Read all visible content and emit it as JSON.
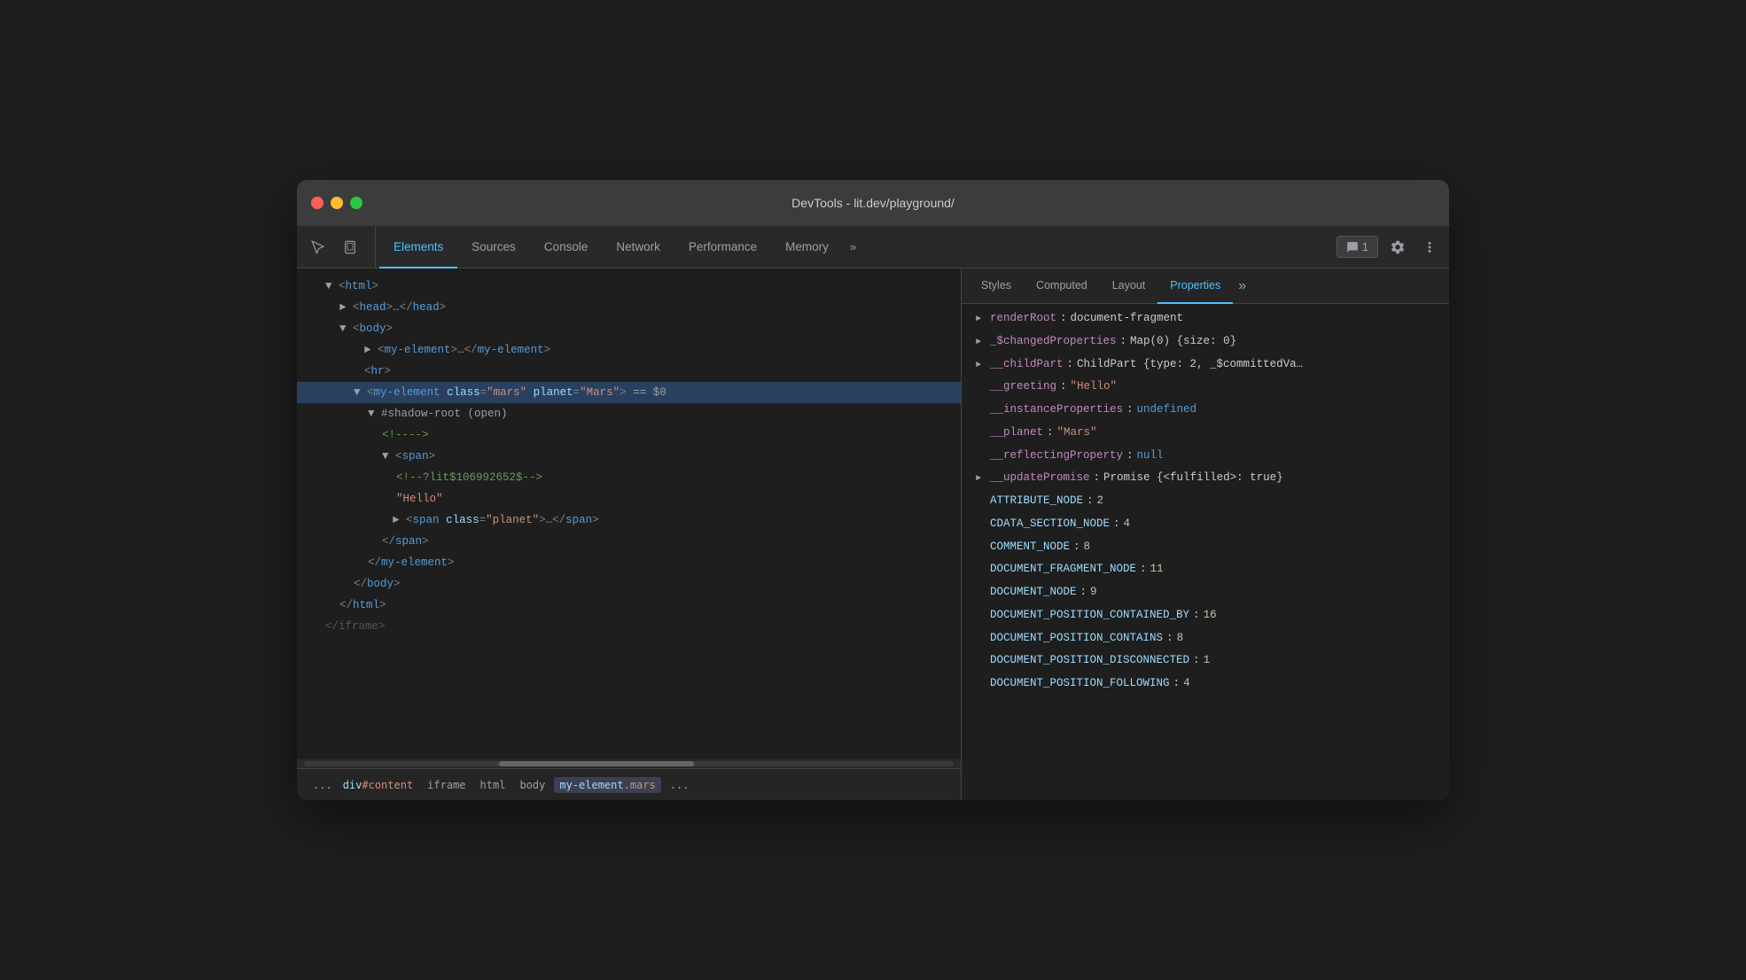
{
  "window": {
    "title": "DevTools - lit.dev/playground/"
  },
  "titlebar": {
    "traffic_lights": [
      "close",
      "minimize",
      "maximize"
    ]
  },
  "tabbar": {
    "tabs": [
      {
        "id": "elements",
        "label": "Elements",
        "active": true
      },
      {
        "id": "sources",
        "label": "Sources",
        "active": false
      },
      {
        "id": "console",
        "label": "Console",
        "active": false
      },
      {
        "id": "network",
        "label": "Network",
        "active": false
      },
      {
        "id": "performance",
        "label": "Performance",
        "active": false
      },
      {
        "id": "memory",
        "label": "Memory",
        "active": false
      }
    ],
    "overflow_label": "»",
    "messages_badge": "1",
    "messages_label": "1"
  },
  "dom_tree": {
    "lines": [
      {
        "indent": 1,
        "content": "▼ <html>",
        "type": "tag"
      },
      {
        "indent": 2,
        "content": "► <head>…</head>",
        "type": "tag"
      },
      {
        "indent": 2,
        "content": "▼ <body>",
        "type": "tag"
      },
      {
        "indent": 3,
        "content": "► <my-element>…</my-element>",
        "type": "tag"
      },
      {
        "indent": 3,
        "content": "<hr>",
        "type": "tag"
      },
      {
        "indent": 3,
        "content": "▼ <my-element class=\"mars\" planet=\"Mars\"> == $0",
        "type": "selected"
      },
      {
        "indent": 4,
        "content": "▼ #shadow-root (open)",
        "type": "shadow"
      },
      {
        "indent": 5,
        "content": "<!---->",
        "type": "comment"
      },
      {
        "indent": 5,
        "content": "▼ <span>",
        "type": "tag"
      },
      {
        "indent": 6,
        "content": "<!--?lit$106992652$-->",
        "type": "comment"
      },
      {
        "indent": 6,
        "content": "\"Hello\"",
        "type": "text"
      },
      {
        "indent": 5,
        "content": "► <span class=\"planet\">…</span>",
        "type": "tag"
      },
      {
        "indent": 5,
        "content": "</span>",
        "type": "tag"
      },
      {
        "indent": 4,
        "content": "</my-element>",
        "type": "tag"
      },
      {
        "indent": 3,
        "content": "</body>",
        "type": "tag"
      },
      {
        "indent": 2,
        "content": "</html>",
        "type": "tag"
      },
      {
        "indent": 1,
        "content": "</iframe>",
        "type": "tag-partial"
      }
    ]
  },
  "breadcrumb": {
    "items": [
      {
        "label": "...",
        "type": "dots"
      },
      {
        "label": "div#content",
        "active": false
      },
      {
        "label": "iframe",
        "active": false
      },
      {
        "label": "html",
        "active": false
      },
      {
        "label": "body",
        "active": false
      },
      {
        "label": "my-element.mars",
        "active": true
      },
      {
        "label": "...",
        "type": "dots-end"
      }
    ]
  },
  "props_panel": {
    "tabs": [
      {
        "label": "Styles",
        "active": false
      },
      {
        "label": "Computed",
        "active": false
      },
      {
        "label": "Layout",
        "active": false
      },
      {
        "label": "Properties",
        "active": true
      }
    ],
    "overflow_label": "»",
    "properties": [
      {
        "arrow": "►",
        "key": "renderRoot",
        "colon": ":",
        "val": "document-fragment",
        "val_type": "object",
        "indent": 0
      },
      {
        "arrow": "►",
        "key": "_$changedProperties",
        "colon": ":",
        "val": "Map(0) {size: 0}",
        "val_type": "object",
        "indent": 0
      },
      {
        "arrow": "►",
        "key": "__childPart",
        "colon": ":",
        "val": "ChildPart {type: 2, _$committedVa…",
        "val_type": "object",
        "indent": 0
      },
      {
        "arrow": "",
        "key": "__greeting",
        "colon": ":",
        "val": "\"Hello\"",
        "val_type": "string",
        "indent": 0
      },
      {
        "arrow": "",
        "key": "__instanceProperties",
        "colon": ":",
        "val": "undefined",
        "val_type": "keyword",
        "indent": 0
      },
      {
        "arrow": "",
        "key": "__planet",
        "colon": ":",
        "val": "\"Mars\"",
        "val_type": "string",
        "indent": 0
      },
      {
        "arrow": "",
        "key": "__reflectingProperty",
        "colon": ":",
        "val": "null",
        "val_type": "null",
        "indent": 0
      },
      {
        "arrow": "►",
        "key": "__updatePromise",
        "colon": ":",
        "val": "Promise {<fulfilled>: true}",
        "val_type": "object",
        "indent": 0
      },
      {
        "arrow": "",
        "key": "ATTRIBUTE_NODE",
        "colon": ":",
        "val": "2",
        "val_type": "number",
        "indent": 0
      },
      {
        "arrow": "",
        "key": "CDATA_SECTION_NODE",
        "colon": ":",
        "val": "4",
        "val_type": "number",
        "indent": 0
      },
      {
        "arrow": "",
        "key": "COMMENT_NODE",
        "colon": ":",
        "val": "8",
        "val_type": "number",
        "indent": 0
      },
      {
        "arrow": "",
        "key": "DOCUMENT_FRAGMENT_NODE",
        "colon": ":",
        "val": "11",
        "val_type": "number",
        "indent": 0
      },
      {
        "arrow": "",
        "key": "DOCUMENT_NODE",
        "colon": ":",
        "val": "9",
        "val_type": "number",
        "indent": 0
      },
      {
        "arrow": "",
        "key": "DOCUMENT_POSITION_CONTAINED_BY",
        "colon": ":",
        "val": "16",
        "val_type": "number",
        "indent": 0
      },
      {
        "arrow": "",
        "key": "DOCUMENT_POSITION_CONTAINS",
        "colon": ":",
        "val": "8",
        "val_type": "number",
        "indent": 0
      },
      {
        "arrow": "",
        "key": "DOCUMENT_POSITION_DISCONNECTED",
        "colon": ":",
        "val": "1",
        "val_type": "number",
        "indent": 0
      },
      {
        "arrow": "",
        "key": "DOCUMENT_POSITION_FOLLOWING",
        "colon": ":",
        "val": "4",
        "val_type": "number",
        "indent": 0
      }
    ]
  }
}
